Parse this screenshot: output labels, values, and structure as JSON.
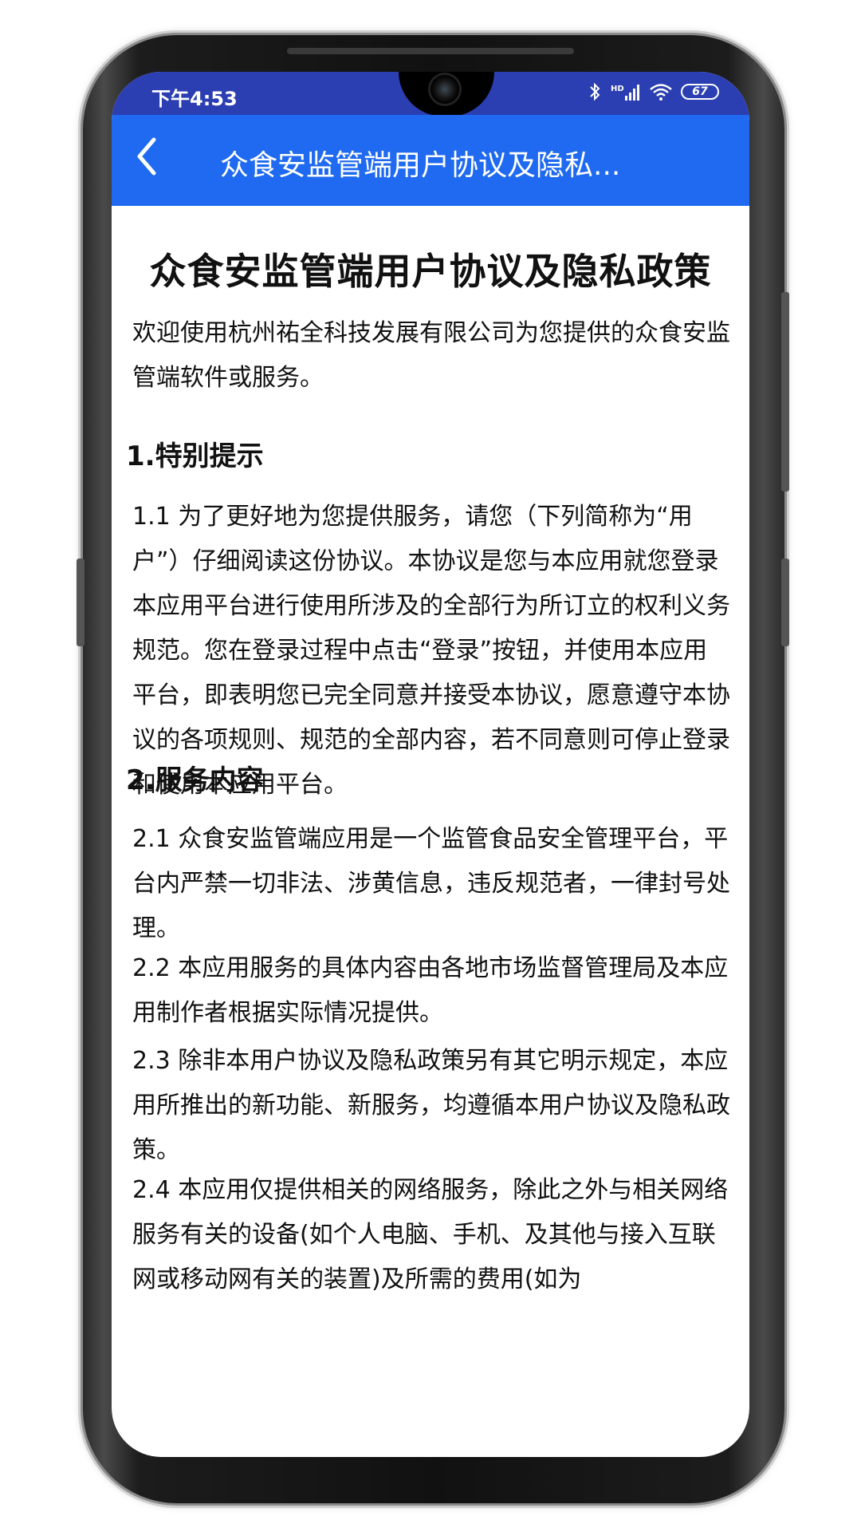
{
  "status_bar": {
    "time": "下午4:53",
    "icons": [
      "bluetooth-icon",
      "hd-signal-icon",
      "wifi-icon"
    ],
    "hd_label": "HD",
    "battery": "67"
  },
  "app_bar": {
    "title": "众食安监管端用户协议及隐私...",
    "back_icon": "chevron-left-icon"
  },
  "document": {
    "title": "众食安监管端用户协议及隐私政策",
    "intro": "欢迎使用杭州祐全科技发展有限公司为您提供的众食安监管端软件或服务。",
    "section1": {
      "heading": "1.特别提示",
      "p1_1": "1.1 为了更好地为您提供服务，请您（下列简称为“用户”）仔细阅读这份协议。本协议是您与本应用就您登录本应用平台进行使用所涉及的全部行为所订立的权利义务规范。您在登录过程中点击“登录”按钮，并使用本应用平台，即表明您已完全同意并接受本协议，愿意遵守本协议的各项规则、规范的全部内容，若不同意则可停止登录和使用本应用平台。"
    },
    "section2": {
      "heading": "2.服务内容",
      "p2_1": "2.1 众食安监管端应用是一个监管食品安全管理平台，平台内严禁一切非法、涉黄信息，违反规范者，一律封号处理。",
      "p2_2": "2.2 本应用服务的具体内容由各地市场监督管理局及本应用制作者根据实际情况提供。",
      "p2_3": "2.3 除非本用户协议及隐私政策另有其它明示规定，本应用所推出的新功能、新服务，均遵循本用户协议及隐私政策。",
      "p2_4": "2.4 本应用仅提供相关的网络服务，除此之外与相关网络服务有关的设备(如个人电脑、手机、及其他与接入互联网或移动网有关的装置)及所需的费用(如为"
    }
  },
  "colors": {
    "status_bar": "#2b3fb2",
    "app_bar": "#1f6af0",
    "text": "#111111"
  }
}
